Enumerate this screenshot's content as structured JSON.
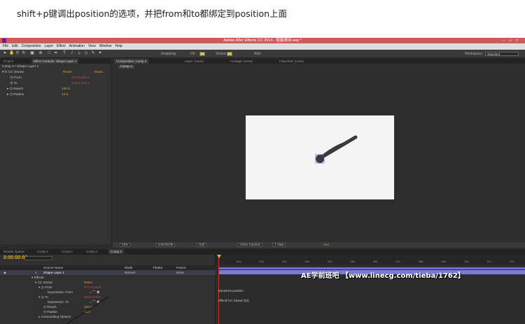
{
  "caption": "shift+p键调出position的选项，并把from和to都绑定到position上面",
  "app": {
    "title": "Adobe After Effects CC 2014 - 智能滚动.aep *",
    "menu": [
      "File",
      "Edit",
      "Composition",
      "Layer",
      "Effect",
      "Animation",
      "View",
      "Window",
      "Help"
    ],
    "toolbar": {
      "snapping": "Snapping",
      "fill": "Fill:",
      "stroke": "Stroke:",
      "add": "Add:",
      "workspace": "Workspace:",
      "workspace_value": "Standard"
    }
  },
  "effect_controls": {
    "tabs": [
      "Project",
      "Effect Controls: Shape Layer 1"
    ],
    "breadcrumb": "Comp 4 • Shape Layer 1",
    "effect_name": "CC Smear",
    "reset": "Reset",
    "about": "About...",
    "props": [
      {
        "label": "From",
        "value": "471.0,344.0"
      },
      {
        "label": "To",
        "value": "449.0,270.0"
      },
      {
        "label": "Reach",
        "value": "183.0"
      },
      {
        "label": "Radius",
        "value": "44.0"
      }
    ]
  },
  "composition": {
    "tabs": [
      "Composition: Comp 4",
      "Layer: (none)",
      "Footage: (none)",
      "Flowchart: (none)"
    ],
    "active_comp": "Comp 4",
    "viewer_bar": {
      "zoom": "22%",
      "timecode": "0:00:00:00",
      "resolution": "Half",
      "camera": "Active Camera",
      "view": "1 View",
      "exposure": "+0.0"
    }
  },
  "timeline": {
    "tabs": [
      "Render Queue",
      "Comp 1",
      "Comp 2",
      "Comp 3",
      "Comp 4"
    ],
    "timecode": "0:00:00:00",
    "columns": {
      "source": "Source Name",
      "mode": "Mode",
      "trkmat": "TrkMat",
      "parent": "Parent"
    },
    "layer": {
      "num": "1",
      "name": "Shape Layer 1",
      "mode": "Normal",
      "parent": "None"
    },
    "rows": [
      {
        "label": "Effects"
      },
      {
        "label": "CC Smear",
        "value": "Reset"
      },
      {
        "label": "From",
        "value": "471.0,344.0"
      },
      {
        "label": "Expression: From"
      },
      {
        "label": "To",
        "value": "449.0,270.0"
      },
      {
        "label": "Expression: To"
      },
      {
        "label": "Reach",
        "value": "183.0"
      },
      {
        "label": "Radius",
        "value": "44.0"
      },
      {
        "label": "Compositing Options"
      }
    ],
    "expressions": [
      "transform.position",
      "effect(\"CC Smear\")(2)"
    ],
    "ruler": [
      "00s",
      "01s",
      "02s",
      "03s",
      "04s",
      "05s",
      "06s",
      "07s",
      "08s",
      "09s",
      "10s",
      "11s",
      "12s",
      "13s"
    ]
  },
  "watermark": "AE学前班吧 【www.linecg.com/tieba/1762】"
}
